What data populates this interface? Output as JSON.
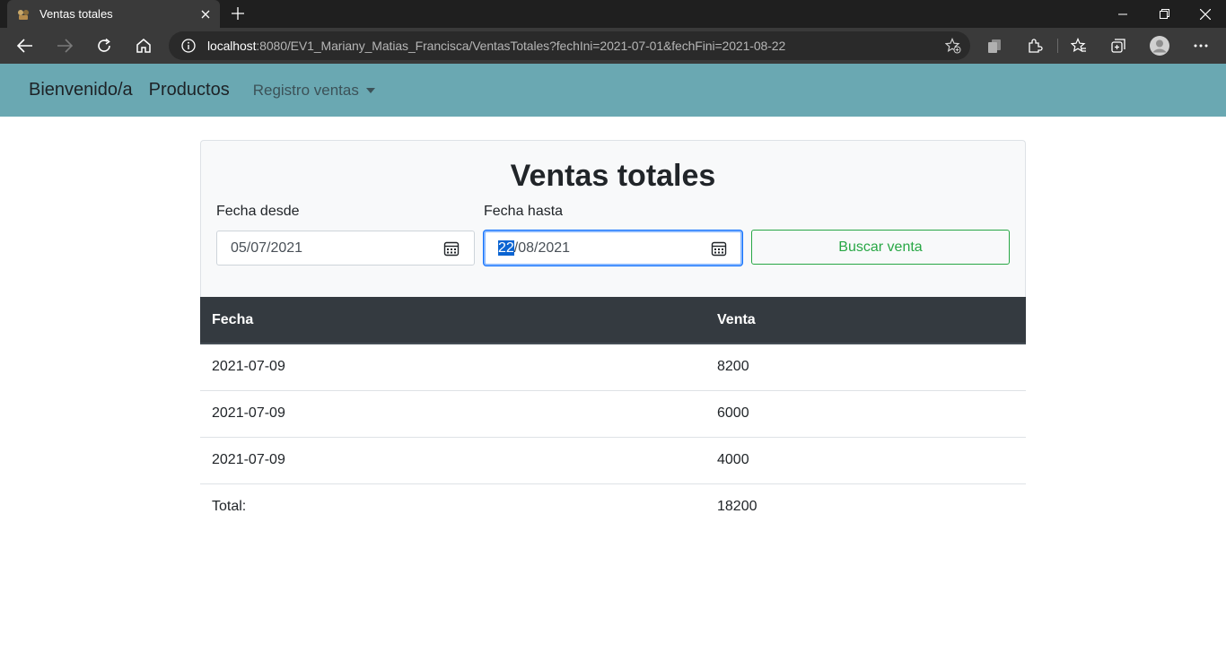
{
  "browser": {
    "tab_title": "Ventas totales",
    "url_host": "localhost",
    "url_rest": ":8080/EV1_Mariany_Matias_Francisca/VentasTotales?fechIni=2021-07-01&fechFini=2021-08-22"
  },
  "navbar": {
    "brand": "Bienvenido/a",
    "products": "Productos",
    "sales_dropdown": "Registro ventas"
  },
  "card": {
    "title": "Ventas totales",
    "from_label": "Fecha desde",
    "from_value": "05/07/2021",
    "to_label": "Fecha hasta",
    "to_value_selected": "22",
    "to_value_rest": "/08/2021",
    "search_button": "Buscar venta"
  },
  "table": {
    "headers": [
      "Fecha",
      "Venta"
    ],
    "rows": [
      [
        "2021-07-09",
        "8200"
      ],
      [
        "2021-07-09",
        "6000"
      ],
      [
        "2021-07-09",
        "4000"
      ]
    ],
    "total_label": "Total:",
    "total_value": "18200"
  },
  "colors": {
    "navbar": "#6aa8b2",
    "table_header": "#343a40",
    "success": "#28a745"
  }
}
